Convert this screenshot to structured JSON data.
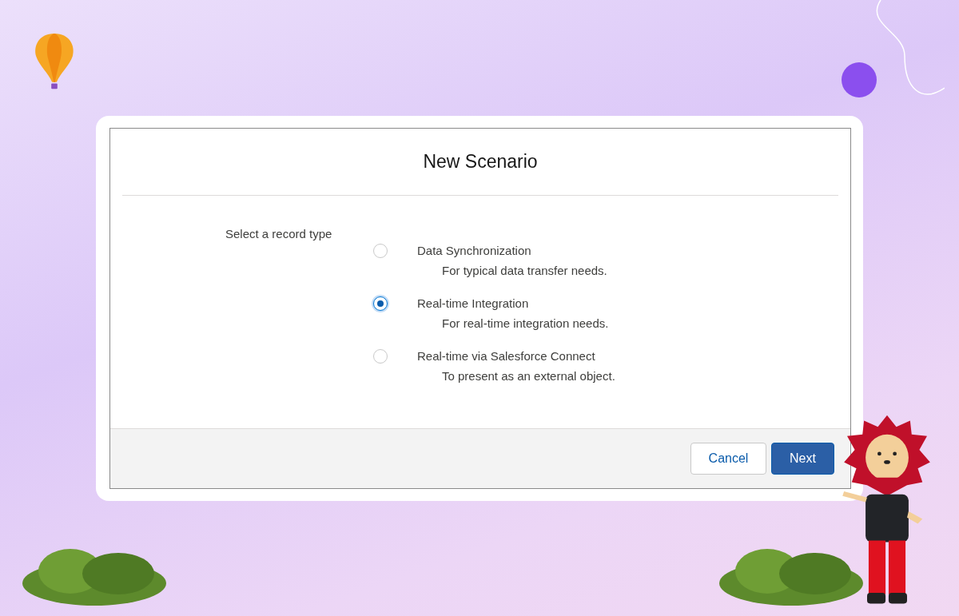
{
  "modal": {
    "title": "New Scenario",
    "prompt": "Select a record type",
    "options": [
      {
        "label": "Data Synchronization",
        "description": "For typical data transfer needs.",
        "selected": false
      },
      {
        "label": "Real-time Integration",
        "description": "For real-time integration needs.",
        "selected": true
      },
      {
        "label": "Real-time via Salesforce Connect",
        "description": "To present as an external object.",
        "selected": false
      }
    ],
    "buttons": [
      {
        "label": "Cancel",
        "kind": "neutral"
      },
      {
        "label": "Next",
        "kind": "brand"
      }
    ]
  }
}
